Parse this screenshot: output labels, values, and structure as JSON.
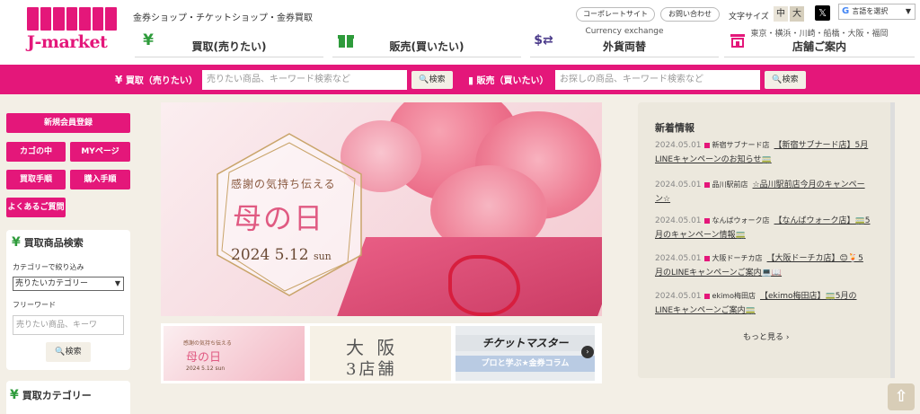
{
  "header": {
    "logo_text": "J-market",
    "tagline": "金券ショップ・チケットショップ・金券買取",
    "nav": [
      {
        "label": "買取(売りたい)",
        "icon": "yen-icon"
      },
      {
        "label": "販売(買いたい)",
        "icon": "gift-icon"
      },
      {
        "label": "外貨両替",
        "sub": "Currency exchange",
        "icon": "currency-exchange-icon"
      },
      {
        "label": "店舗ご案内",
        "sub": "東京・横浜・川崎・船橋・大阪・福岡",
        "icon": "store-icon"
      }
    ],
    "corporate_label": "コーポレートサイト",
    "contact_label": "お問い合わせ",
    "fontsize_label": "文字サイズ",
    "fontsize_medium": "中",
    "fontsize_large": "大",
    "x_label": "𝕏",
    "lang_label": "言語を選択",
    "lang_caret": "▼"
  },
  "searchbar": {
    "buy_label": "買取（売りたい）",
    "buy_placeholder": "売りたい商品、キーワード検索など",
    "sell_label": "販売（買いたい）",
    "sell_placeholder": "お探しの商品、キーワード検索など",
    "search_label": "検索"
  },
  "sidebar": {
    "register": "新規会員登録",
    "cart": "カゴの中",
    "mypage": "MYページ",
    "buy_procedure": "買取手順",
    "purchase_procedure": "購入手順",
    "faq": "よくあるご質問",
    "search_title": "買取商品検索",
    "category_label": "カテゴリーで絞り込み",
    "category_select": "売りたいカテゴリー",
    "freeword_label": "フリーワード",
    "freeword_placeholder": "売りたい商品、キーワ",
    "search_button": "検索",
    "category_title": "買取カテゴリー"
  },
  "banner": {
    "line1": "感謝の気持ち伝える",
    "line2": "母の日",
    "date": "2024 5.12",
    "day": "sun"
  },
  "thumbs": {
    "t1_line1": "感謝の気持ち伝える",
    "t1_line2": "母の日",
    "t1_date": "2024 5.12 sun",
    "t2_line1": "大 阪",
    "t2_line2": "3店舗",
    "t3_line1": "チケットマスター",
    "t3_line2": "プロと学ぶ★金券コラム"
  },
  "news": {
    "title": "新着情報",
    "items": [
      {
        "date": "2024.05.01",
        "store": "新宿サブナード店",
        "text": "【新宿サブナード店】5月LINEキャンペーンのお知らせ🚃"
      },
      {
        "date": "2024.05.01",
        "store": "品川駅前店",
        "text": "☆品川駅前店今月のキャンペーン☆"
      },
      {
        "date": "2024.05.01",
        "store": "なんばウォーク店",
        "text": "【なんばウォーク店】🚃5月のキャンペーン情報🚃"
      },
      {
        "date": "2024.05.01",
        "store": "大阪ドーチカ店",
        "text": "【大阪ドーチカ店】😊🍹5月のLINEキャンペーンご案内💻📖"
      },
      {
        "date": "2024.05.01",
        "store": "ekimo梅田店",
        "text": "【ekimo梅田店】🚃5月のLINEキャンペーンご案内🚃"
      }
    ],
    "more": "もっと見る"
  },
  "pagetop": "⇧"
}
